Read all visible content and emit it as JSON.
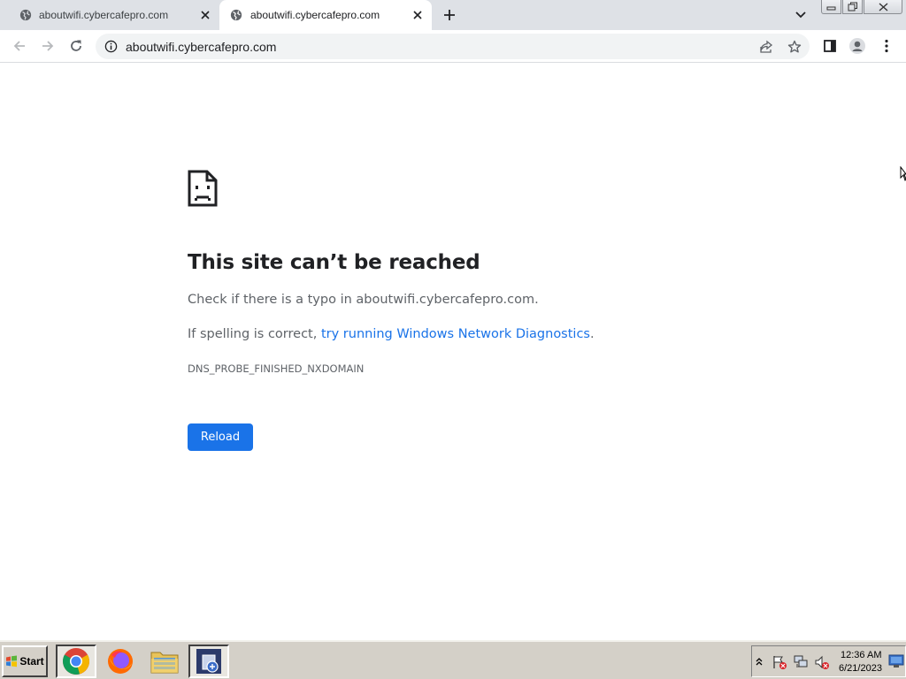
{
  "browser": {
    "tabs": [
      {
        "title": "aboutwifi.cybercafepro.com",
        "active": false
      },
      {
        "title": "aboutwifi.cybercafepro.com",
        "active": true
      }
    ],
    "address_bar": {
      "url": "aboutwifi.cybercafepro.com"
    }
  },
  "error_page": {
    "title": "This site can’t be reached",
    "line1": "Check if there is a typo in aboutwifi.cybercafepro.com.",
    "line2_prefix": "If spelling is correct, ",
    "line2_link": "try running Windows Network Diagnostics",
    "line2_suffix": ".",
    "error_code": "DNS_PROBE_FINISHED_NXDOMAIN",
    "reload_label": "Reload"
  },
  "taskbar": {
    "start_label": "Start",
    "apps": [
      "chrome-icon",
      "firefox-icon",
      "file-explorer-icon",
      "network-settings-icon"
    ],
    "clock": {
      "time": "12:36 AM",
      "date": "6/21/2023"
    }
  },
  "colors": {
    "accent": "#1a73e8",
    "tab_strip": "#dee1e6",
    "taskbar": "#d4d0c8"
  }
}
